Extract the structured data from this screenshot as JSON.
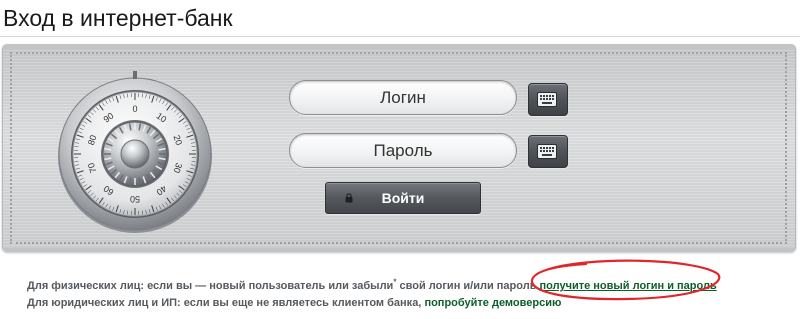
{
  "header": {
    "title": "Вход в интернет-банк"
  },
  "form": {
    "login_placeholder": "Логин",
    "password_placeholder": "Пароль",
    "submit_label": "Войти"
  },
  "safe": {
    "dial_numbers": [
      "0",
      "10",
      "20",
      "30",
      "40",
      "50",
      "60",
      "70",
      "80",
      "90"
    ]
  },
  "info": {
    "individuals_text": "Для физических лиц: если вы — новый пользователь или забыли",
    "individuals_mark": "*",
    "individuals_text_2": " свой логин и/или пароль",
    "individuals_link": "получите новый логин и пароль",
    "legal_text": "Для юридических лиц и ИП: если вы еще не являетесь клиентом банка,",
    "legal_link": "попробуйте демоверсию"
  },
  "colors": {
    "link": "#0e5e2a",
    "annotation": "#e0262b",
    "button": "#55595e"
  }
}
